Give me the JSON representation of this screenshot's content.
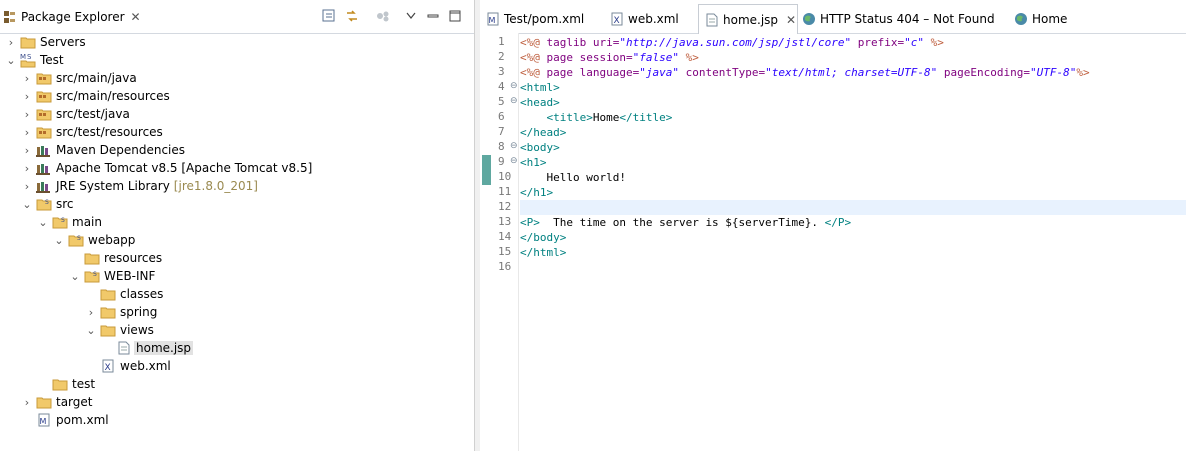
{
  "explorer": {
    "title": "Package Explorer",
    "close": "✕",
    "tree": [
      {
        "label": "Servers",
        "icon": "folder-icon"
      },
      {
        "label": "Test",
        "icon": "maven-project-icon"
      },
      {
        "label": "src/main/java",
        "icon": "source-folder-icon"
      },
      {
        "label": "src/main/resources",
        "icon": "source-folder-icon"
      },
      {
        "label": "src/test/java",
        "icon": "source-folder-icon"
      },
      {
        "label": "src/test/resources",
        "icon": "source-folder-icon"
      },
      {
        "label": "Maven Dependencies",
        "icon": "library-icon"
      },
      {
        "label": "Apache Tomcat v8.5 [Apache Tomcat v8.5]",
        "icon": "library-icon"
      },
      {
        "label": "JRE System Library",
        "decoration": "[jre1.8.0_201]",
        "icon": "library-icon"
      },
      {
        "label": "src",
        "icon": "folder-icon"
      },
      {
        "label": "main",
        "icon": "folder-icon"
      },
      {
        "label": "webapp",
        "icon": "folder-icon"
      },
      {
        "label": "resources",
        "icon": "folder-icon"
      },
      {
        "label": "WEB-INF",
        "icon": "folder-icon"
      },
      {
        "label": "classes",
        "icon": "folder-icon"
      },
      {
        "label": "spring",
        "icon": "folder-icon"
      },
      {
        "label": "views",
        "icon": "folder-icon"
      },
      {
        "label": "home.jsp",
        "icon": "jsp-file-icon"
      },
      {
        "label": "web.xml",
        "icon": "xml-file-icon"
      },
      {
        "label": "test",
        "icon": "folder-icon"
      },
      {
        "label": "target",
        "icon": "folder-icon"
      },
      {
        "label": "pom.xml",
        "icon": "maven-pom-icon"
      }
    ]
  },
  "editor": {
    "tabs": [
      {
        "label": "Test/pom.xml",
        "icon": "maven-pom-icon"
      },
      {
        "label": "web.xml",
        "icon": "xml-file-icon"
      },
      {
        "label": "home.jsp",
        "icon": "jsp-file-icon",
        "active": true,
        "close": "✕"
      },
      {
        "label": "HTTP Status 404 – Not Found",
        "icon": "globe-icon"
      },
      {
        "label": "Home",
        "icon": "globe-icon"
      }
    ],
    "line_numbers": [
      "1",
      "2",
      "3",
      "4",
      "5",
      "6",
      "7",
      "8",
      "9",
      "10",
      "11",
      "12",
      "13",
      "14",
      "15",
      "16"
    ],
    "lines": [
      [
        [
          "dir",
          "<%@ "
        ],
        [
          "an",
          "taglib "
        ],
        [
          "an",
          "uri="
        ],
        [
          "av",
          "\"http://java.sun.com/jsp/jstl/core\""
        ],
        [
          "an",
          " prefix="
        ],
        [
          "av",
          "\"c\""
        ],
        [
          "dir",
          " %>"
        ]
      ],
      [
        [
          "dir",
          "<%@ "
        ],
        [
          "an",
          "page "
        ],
        [
          "an",
          "session="
        ],
        [
          "av",
          "\"false\""
        ],
        [
          "dir",
          " %>"
        ]
      ],
      [
        [
          "dir",
          "<%@ "
        ],
        [
          "an",
          "page "
        ],
        [
          "an",
          "language="
        ],
        [
          "av",
          "\"java\""
        ],
        [
          "an",
          " contentType="
        ],
        [
          "av",
          "\"text/html; charset=UTF-8\""
        ],
        [
          "an",
          " pageEncoding="
        ],
        [
          "av",
          "\"UTF-8\""
        ],
        [
          "dir",
          "%>"
        ]
      ],
      [
        [
          "tg",
          "<html>"
        ]
      ],
      [
        [
          "tg",
          "<head>"
        ]
      ],
      [
        [
          "tx",
          "    "
        ],
        [
          "tg",
          "<title>"
        ],
        [
          "tx",
          "Home"
        ],
        [
          "tg",
          "</title>"
        ]
      ],
      [
        [
          "tg",
          "</head>"
        ]
      ],
      [
        [
          "tg",
          "<body>"
        ]
      ],
      [
        [
          "tg",
          "<h1>"
        ]
      ],
      [
        [
          "tx",
          "    Hello world!"
        ]
      ],
      [
        [
          "tg",
          "</h1>"
        ]
      ],
      [
        [
          "tx",
          ""
        ]
      ],
      [
        [
          "tg",
          "<P>"
        ],
        [
          "tx",
          "  The time on the server is ${serverTime}. "
        ],
        [
          "tg",
          "</P>"
        ]
      ],
      [
        [
          "tg",
          "</body>"
        ]
      ],
      [
        [
          "tg",
          "</html>"
        ]
      ],
      [
        [
          "tx",
          ""
        ]
      ]
    ]
  }
}
